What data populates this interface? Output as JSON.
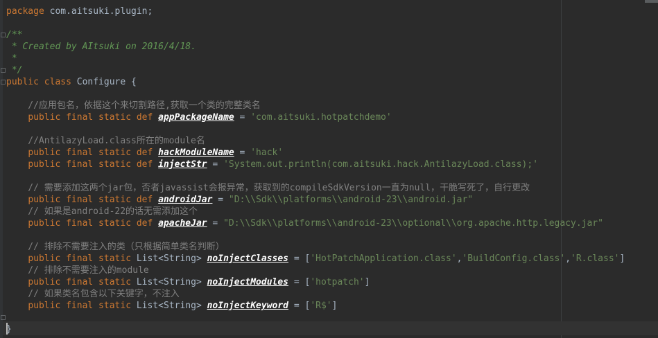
{
  "lines": [
    {
      "segs": [
        {
          "t": "package",
          "c": "kw"
        },
        {
          "t": " com.aitsuki.plugin;"
        }
      ]
    },
    {
      "segs": []
    },
    {
      "segs": [
        {
          "t": "/**",
          "c": "doc"
        }
      ]
    },
    {
      "segs": [
        {
          "t": " * Created by AItsuki on 2016/4/18.",
          "c": "doc"
        }
      ]
    },
    {
      "segs": [
        {
          "t": " *",
          "c": "doc"
        }
      ]
    },
    {
      "segs": [
        {
          "t": " */",
          "c": "doc"
        }
      ]
    },
    {
      "segs": [
        {
          "t": "public class",
          "c": "kw"
        },
        {
          "t": " Configure {"
        }
      ]
    },
    {
      "segs": []
    },
    {
      "segs": [
        {
          "t": "    //应用包名，依据这个来切割路径,获取一个类的完整类名",
          "c": "cm"
        }
      ]
    },
    {
      "segs": [
        {
          "t": "    "
        },
        {
          "t": "public final static def",
          "c": "kw"
        },
        {
          "t": " "
        },
        {
          "t": "appPackageName",
          "c": "fld"
        },
        {
          "t": " = "
        },
        {
          "t": "'com.aitsuki.hotpatchdemo'",
          "c": "str"
        }
      ]
    },
    {
      "segs": []
    },
    {
      "segs": [
        {
          "t": "    //AntilazyLoad.class所在的module名",
          "c": "cm"
        }
      ]
    },
    {
      "segs": [
        {
          "t": "    "
        },
        {
          "t": "public final static def",
          "c": "kw"
        },
        {
          "t": " "
        },
        {
          "t": "hackModuleName",
          "c": "fld"
        },
        {
          "t": " = "
        },
        {
          "t": "'hack'",
          "c": "str"
        }
      ]
    },
    {
      "segs": [
        {
          "t": "    "
        },
        {
          "t": "public final static def",
          "c": "kw"
        },
        {
          "t": " "
        },
        {
          "t": "injectStr",
          "c": "fld"
        },
        {
          "t": " = "
        },
        {
          "t": "'System.out.println(com.aitsuki.hack.AntilazyLoad.class);'",
          "c": "str"
        }
      ]
    },
    {
      "segs": []
    },
    {
      "segs": [
        {
          "t": "    // 需要添加这两个jar包，否者javassist会报异常，获取到的compileSdkVersion一直为null，干脆写死了，自行更改",
          "c": "cm"
        }
      ]
    },
    {
      "segs": [
        {
          "t": "    "
        },
        {
          "t": "public final static def",
          "c": "kw"
        },
        {
          "t": " "
        },
        {
          "t": "androidJar",
          "c": "fld"
        },
        {
          "t": " = "
        },
        {
          "t": "\"D:\\\\Sdk\\\\platforms\\\\android-23\\\\android.jar\"",
          "c": "str"
        }
      ]
    },
    {
      "segs": [
        {
          "t": "    // 如果是android-22的话无需添加这个",
          "c": "cm"
        }
      ]
    },
    {
      "segs": [
        {
          "t": "    "
        },
        {
          "t": "public final static def",
          "c": "kw"
        },
        {
          "t": " "
        },
        {
          "t": "apacheJar",
          "c": "fld"
        },
        {
          "t": " = "
        },
        {
          "t": "\"D:\\\\Sdk\\\\platforms\\\\android-23\\\\optional\\\\org.apache.http.legacy.jar\"",
          "c": "str"
        }
      ]
    },
    {
      "segs": []
    },
    {
      "segs": [
        {
          "t": "    // 排除不需要注入的类（只根据简单类名判断）",
          "c": "cm"
        }
      ]
    },
    {
      "segs": [
        {
          "t": "    "
        },
        {
          "t": "public final static",
          "c": "kw"
        },
        {
          "t": " List<String> "
        },
        {
          "t": "noInjectClasses",
          "c": "fld"
        },
        {
          "t": " = ["
        },
        {
          "t": "'HotPatchApplication.class'",
          "c": "str"
        },
        {
          "t": ","
        },
        {
          "t": "'BuildConfig.class'",
          "c": "str"
        },
        {
          "t": ","
        },
        {
          "t": "'R.class'",
          "c": "str"
        },
        {
          "t": "]"
        }
      ]
    },
    {
      "segs": [
        {
          "t": "    // 排除不需要注入的module",
          "c": "cm"
        }
      ]
    },
    {
      "segs": [
        {
          "t": "    "
        },
        {
          "t": "public final static",
          "c": "kw"
        },
        {
          "t": " List<String> "
        },
        {
          "t": "noInjectModules",
          "c": "fld"
        },
        {
          "t": " = ["
        },
        {
          "t": "'hotpatch'",
          "c": "str"
        },
        {
          "t": "]"
        }
      ]
    },
    {
      "segs": [
        {
          "t": "    // 如果类名包含以下关键字，不注入",
          "c": "cm"
        }
      ]
    },
    {
      "segs": [
        {
          "t": "    "
        },
        {
          "t": "public final static",
          "c": "kw"
        },
        {
          "t": " List<String> "
        },
        {
          "t": "noInjectKeyword",
          "c": "fld"
        },
        {
          "t": " = ["
        },
        {
          "t": "'R$'",
          "c": "str"
        },
        {
          "t": "]"
        }
      ]
    },
    {
      "segs": []
    },
    {
      "segs": [
        {
          "t": "}"
        }
      ]
    }
  ]
}
